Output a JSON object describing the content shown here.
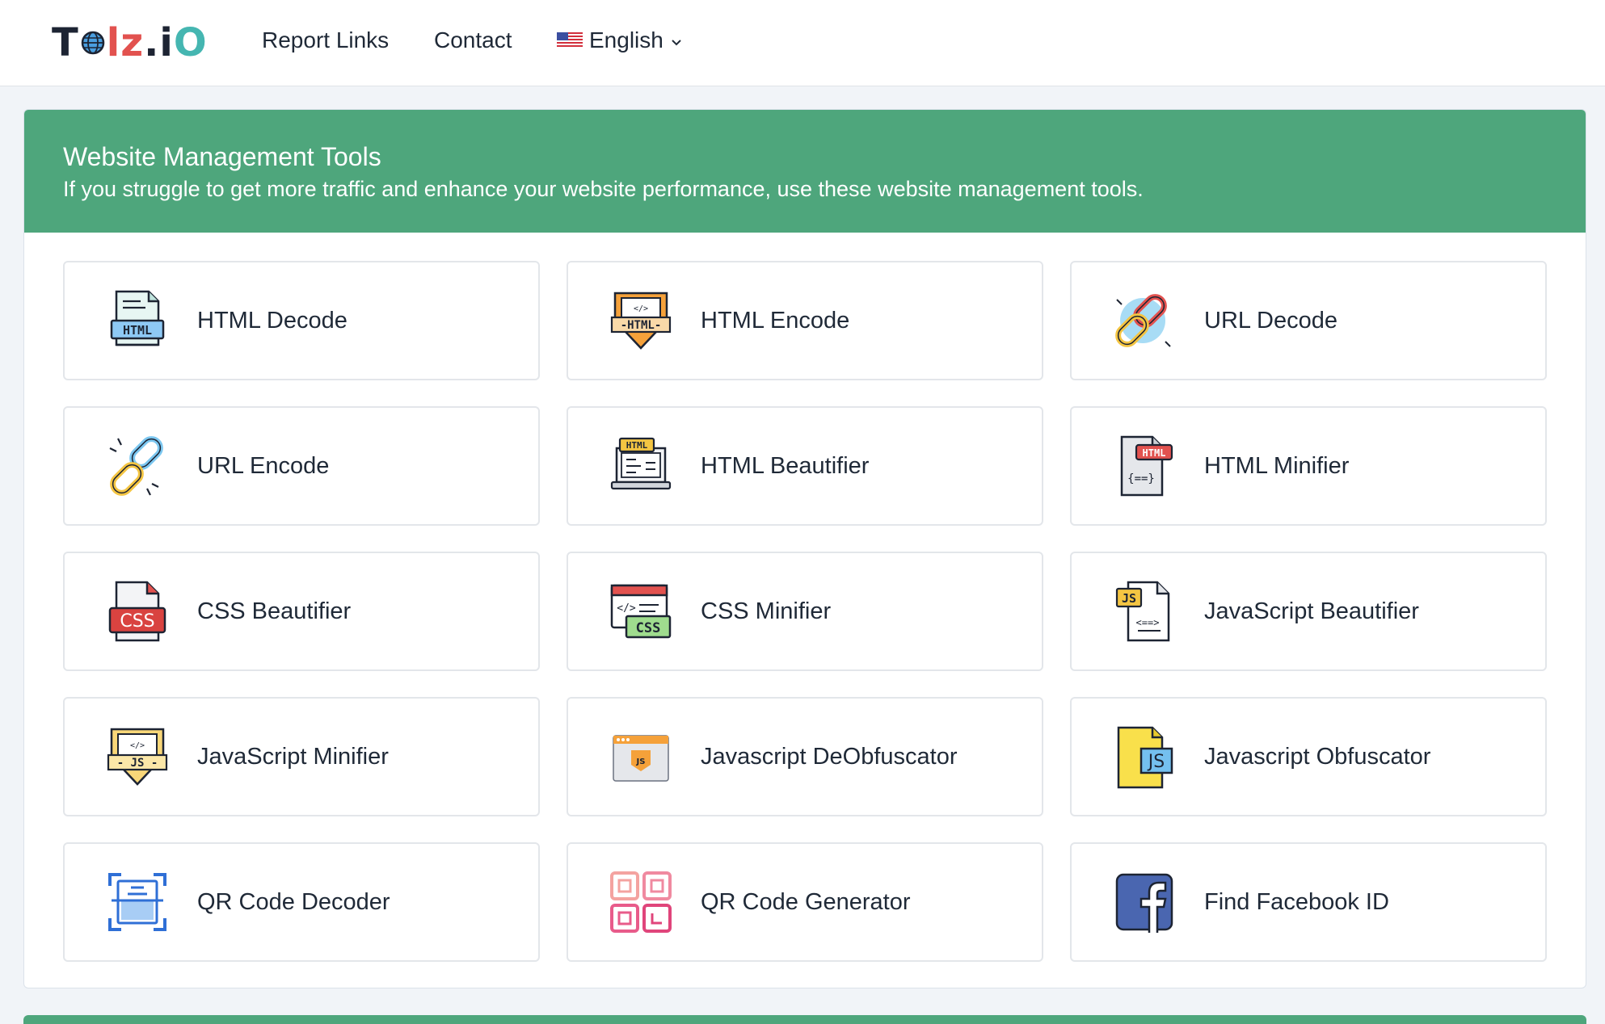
{
  "brand": {
    "logo": "Tolz.iO"
  },
  "nav": {
    "links": [
      {
        "label": "Report Links"
      },
      {
        "label": "Contact"
      }
    ],
    "language": {
      "label": "English",
      "flag": "us-flag-icon"
    }
  },
  "section": {
    "title": "Website Management Tools",
    "subtitle": "If you struggle to get more traffic and enhance your website performance, use these website management tools.",
    "accent_color": "#4ea67c"
  },
  "tools": [
    {
      "label": "HTML Decode",
      "icon": "html-document-icon"
    },
    {
      "label": "HTML Encode",
      "icon": "html-badge-icon"
    },
    {
      "label": "URL Decode",
      "icon": "chain-link-icon"
    },
    {
      "label": "URL Encode",
      "icon": "broken-link-icon"
    },
    {
      "label": "HTML Beautifier",
      "icon": "html-laptop-icon"
    },
    {
      "label": "HTML Minifier",
      "icon": "html-file-icon"
    },
    {
      "label": "CSS Beautifier",
      "icon": "css-file-icon"
    },
    {
      "label": "CSS Minifier",
      "icon": "css-window-icon"
    },
    {
      "label": "JavaScript Beautifier",
      "icon": "js-file-icon"
    },
    {
      "label": "JavaScript Minifier",
      "icon": "js-badge-icon"
    },
    {
      "label": "Javascript DeObfuscator",
      "icon": "js-browser-icon"
    },
    {
      "label": "Javascript Obfuscator",
      "icon": "js-yellow-file-icon"
    },
    {
      "label": "QR Code Decoder",
      "icon": "qr-scan-icon"
    },
    {
      "label": "QR Code Generator",
      "icon": "qr-code-icon"
    },
    {
      "label": "Find Facebook ID",
      "icon": "facebook-icon"
    }
  ]
}
